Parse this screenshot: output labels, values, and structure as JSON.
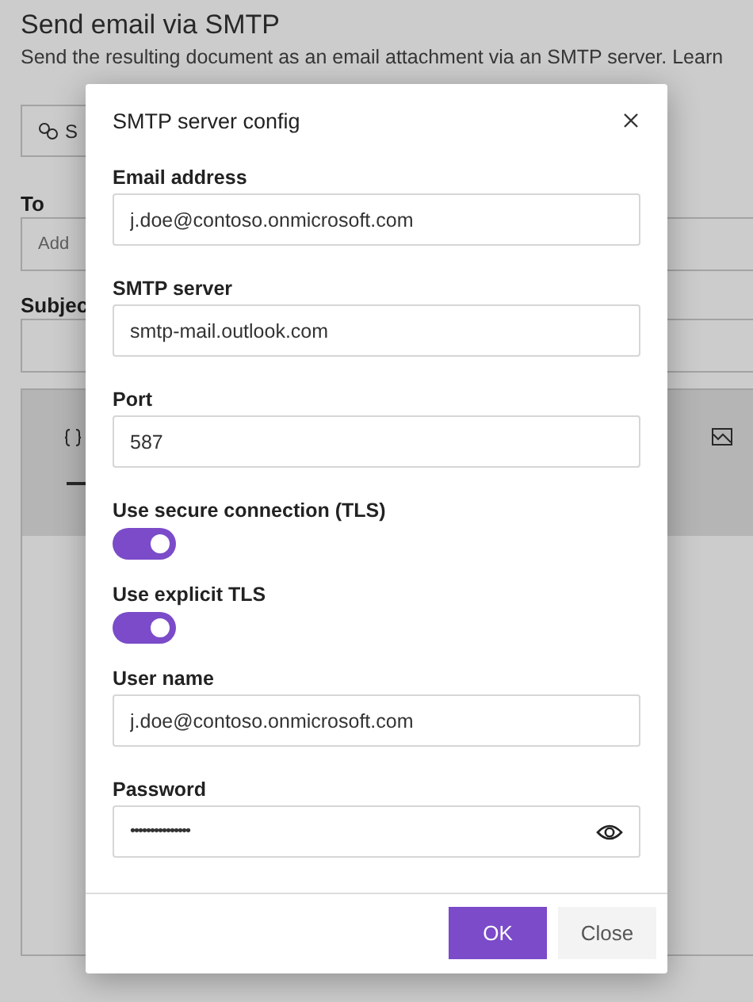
{
  "page": {
    "title": "Send email via SMTP",
    "description": "Send the resulting document as an email attachment via an SMTP server. Learn",
    "config_button": "S",
    "to": {
      "label": "To",
      "placeholder": "Add"
    },
    "subject": {
      "label": "Subjec"
    }
  },
  "dialog": {
    "title": "SMTP server config",
    "fields": [
      {
        "kind": "text",
        "label": "Email address",
        "value": "j.doe@contoso.onmicrosoft.com"
      },
      {
        "kind": "text",
        "label": "SMTP server",
        "value": "smtp-mail.outlook.com"
      },
      {
        "kind": "text",
        "label": "Port",
        "value": "587"
      },
      {
        "kind": "toggle",
        "label": "Use secure connection (TLS)",
        "on": true
      },
      {
        "kind": "toggle",
        "label": "Use explicit TLS",
        "on": true
      },
      {
        "kind": "text",
        "label": "User name",
        "value": "j.doe@contoso.onmicrosoft.com"
      },
      {
        "kind": "password",
        "label": "Password",
        "value": "•••••••••••••••"
      }
    ],
    "buttons": [
      {
        "label": "OK",
        "kind": "primary"
      },
      {
        "label": "Close",
        "kind": "secondary"
      }
    ]
  }
}
